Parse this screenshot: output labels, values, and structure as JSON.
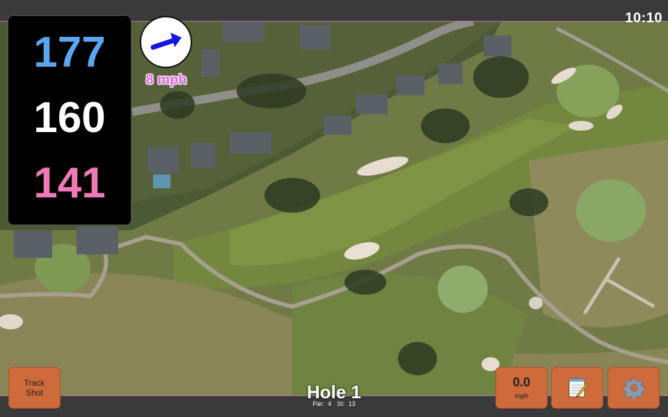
{
  "status": {
    "time": "10:10"
  },
  "distances": {
    "back": "177",
    "middle": "160",
    "front": "141"
  },
  "wind": {
    "label": "8 mph",
    "direction_icon": "arrow-up-right-icon"
  },
  "hole": {
    "title": "Hole 1",
    "par": "Par: 4",
    "stroke_index": "SI: 13"
  },
  "buttons": {
    "track_shot_line1": "Track",
    "track_shot_line2": "Shot",
    "wind_speed": "0.0",
    "wind_unit": "mph",
    "notes_icon": "notepad-icon",
    "settings_icon": "gear-icon"
  },
  "colors": {
    "back_distance": "#5aa6f0",
    "middle_distance": "#ffffff",
    "front_distance": "#f07ab6",
    "button": "#cf6a3b",
    "wind_text": "#e55fe0"
  }
}
